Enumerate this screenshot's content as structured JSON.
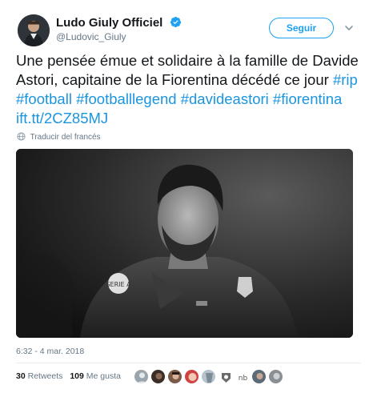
{
  "account": {
    "display_name": "Ludo Giuly Officiel",
    "handle": "@Ludovic_Giuly",
    "verified": true,
    "avatar_icon": "profile-photo"
  },
  "actions": {
    "follow_label": "Seguir",
    "more_icon": "chevron-down-icon"
  },
  "tweet": {
    "text_parts": [
      {
        "text": "Une pensée émue et solidaire à la famille de Davide Astori, capitaine de la Fiorentina décédé ce jour ",
        "kind": "plain"
      },
      {
        "text": "#rip",
        "kind": "link"
      },
      {
        "text": " ",
        "kind": "plain"
      },
      {
        "text": "#football",
        "kind": "link"
      },
      {
        "text": " ",
        "kind": "plain"
      },
      {
        "text": "#footballlegend",
        "kind": "link"
      },
      {
        "text": " ",
        "kind": "plain"
      },
      {
        "text": "#davideastori",
        "kind": "link"
      },
      {
        "text": " ",
        "kind": "plain"
      },
      {
        "text": "#fiorentina",
        "kind": "link"
      },
      {
        "text": " ",
        "kind": "plain"
      },
      {
        "text": "ift.tt/2CZ85MJ",
        "kind": "link"
      }
    ],
    "translate_label": "Traducir del francés",
    "timestamp": "6:32 - 4 mar. 2018"
  },
  "stats": {
    "retweets_count": "30",
    "retweets_label": "Retweets",
    "likes_count": "109",
    "likes_label": "Me gusta"
  },
  "colors": {
    "link": "#1b95e0",
    "accent": "#1da1f2",
    "muted": "#657786",
    "text": "#14171a"
  }
}
